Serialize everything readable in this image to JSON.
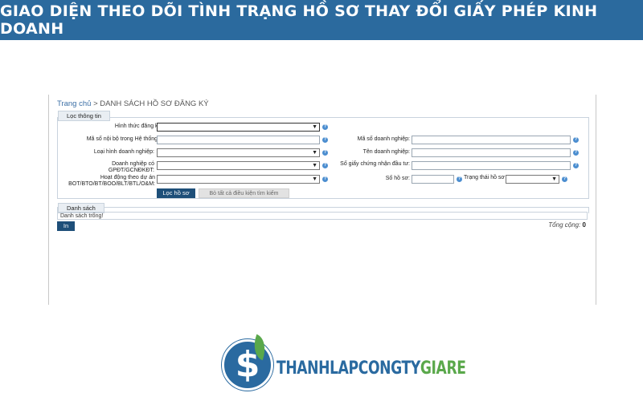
{
  "banner": {
    "title": "GIAO DIỆN THEO DÕI TÌNH TRẠNG HỒ SƠ THAY ĐỔI GIẤY PHÉP KINH DOANH"
  },
  "breadcrumb": {
    "home": "Trang chủ",
    "separator": ">",
    "current": "DANH SÁCH HỒ SƠ ĐĂNG KÝ"
  },
  "filter": {
    "legend": "Lọc thông tin",
    "fields": {
      "registration_type": "Hình thức đăng ký:",
      "internal_code": "Mã số nội bộ trong Hệ thống:",
      "business_type": "Loại hình doanh nghiệp:",
      "has_certificate": "Doanh nghiệp có GPĐT/GCNĐKĐT:",
      "project_activity": "Hoạt động theo dự án BOT/BTO/BT/BOO/BLT/BTL/O&M:",
      "enterprise_code": "Mã số doanh nghiệp:",
      "enterprise_name": "Tên doanh nghiệp:",
      "investment_certificate": "Số giấy chứng nhận đầu tư:",
      "file_number": "Số hồ sơ:",
      "file_status": "Trạng thái hồ sơ"
    },
    "help_glyph": "?",
    "filter_button": "Lọc hồ sơ",
    "clear_button": "Bỏ tất cả điều kiện tìm kiếm"
  },
  "list": {
    "legend": "Danh sách",
    "empty_message": "Danh sách trống!",
    "print_button": "In",
    "total_label": "Tổng cộng:",
    "total_value": "0"
  },
  "logo": {
    "text_part1": "THANHLAPCONGTY",
    "text_part2": "GIARE",
    "symbol": "$"
  },
  "colors": {
    "banner": "#2b6a9e",
    "primary_button": "#1e4f79",
    "help_icon": "#4c8ed0",
    "logo_blue": "#2a6aa0",
    "logo_green": "#5aa84b"
  }
}
